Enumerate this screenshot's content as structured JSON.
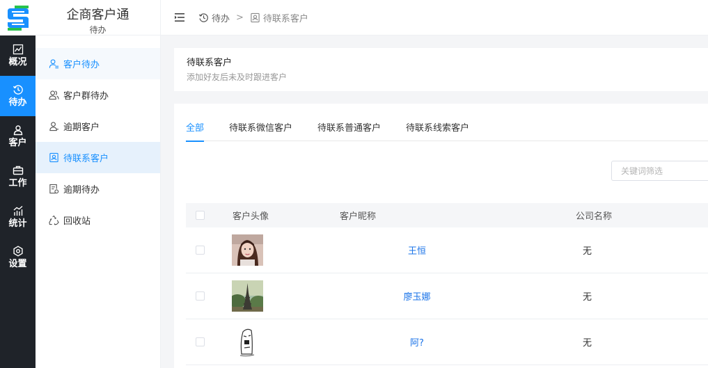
{
  "app": {
    "title": "企商客户通",
    "subtitle": "待办"
  },
  "rail": {
    "items": [
      {
        "label": "概况",
        "icon": "chart-icon"
      },
      {
        "label": "待办",
        "icon": "clock-icon",
        "active": true
      },
      {
        "label": "客户",
        "icon": "user-icon"
      },
      {
        "label": "工作",
        "icon": "briefcase-icon"
      },
      {
        "label": "统计",
        "icon": "stats-icon"
      },
      {
        "label": "设置",
        "icon": "gear-icon"
      }
    ]
  },
  "sidebar": {
    "items": [
      {
        "label": "客户待办",
        "icon": "user-todo-icon"
      },
      {
        "label": "客户群待办",
        "icon": "group-icon"
      },
      {
        "label": "逾期客户",
        "icon": "user-overdue-icon"
      },
      {
        "label": "待联系客户",
        "icon": "contact-card-icon",
        "active": true
      },
      {
        "label": "逾期待办",
        "icon": "document-icon"
      },
      {
        "label": "回收站",
        "icon": "recycle-icon"
      }
    ]
  },
  "breadcrumb": {
    "items": [
      "待办",
      "待联系客户"
    ],
    "separator": ">"
  },
  "page": {
    "title": "待联系客户",
    "description": "添加好友后未及时跟进客户"
  },
  "tabs": [
    "全部",
    "待联系微信客户",
    "待联系普通客户",
    "待联系线索客户"
  ],
  "search": {
    "placeholder": "关键词筛选",
    "value": ""
  },
  "table": {
    "headers": [
      "客户头像",
      "客户昵称",
      "公司名称"
    ],
    "rows": [
      {
        "nickname": "王恒",
        "company": "无",
        "avatar": "portrait-photo"
      },
      {
        "nickname": "廖玉娜",
        "company": "无",
        "avatar": "eiffel-tower-photo"
      },
      {
        "nickname": "阿?",
        "company": "无",
        "avatar": "sketch-drawing"
      }
    ]
  },
  "colors": {
    "accent": "#1890ff",
    "rail": "#1f2329",
    "link": "#1a73e8"
  }
}
